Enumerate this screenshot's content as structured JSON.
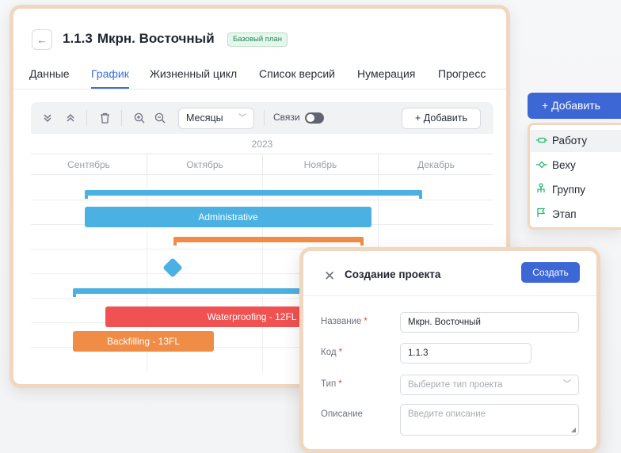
{
  "project": {
    "code": "1.1.3",
    "name": "Мкрн. Восточный",
    "plan_badge": "Базовый план",
    "back_icon": "arrow-left-icon"
  },
  "tabs": [
    {
      "label": "Данные",
      "active": false
    },
    {
      "label": "График",
      "active": true
    },
    {
      "label": "Жизненный цикл",
      "active": false
    },
    {
      "label": "Список версий",
      "active": false
    },
    {
      "label": "Нумерация",
      "active": false
    },
    {
      "label": "Прогресс",
      "active": false
    }
  ],
  "toolbar": {
    "expand_icon": "chevrons-down-icon",
    "collapse_icon": "chevrons-up-icon",
    "delete_icon": "trash-icon",
    "zoom_in_icon": "zoom-in-icon",
    "zoom_out_icon": "zoom-out-icon",
    "scale_select": "Месяцы",
    "links_label": "Связи",
    "links_enabled": false,
    "add_label": "+ Добавить"
  },
  "gantt": {
    "year": "2023",
    "months": [
      "Сентябрь",
      "Октябрь",
      "Ноябрь",
      "Декабрь"
    ],
    "bars": [
      {
        "type": "summary",
        "color": "#4bb1e3"
      },
      {
        "type": "task",
        "label": "Administrative",
        "color": "#4bb1e3"
      },
      {
        "type": "summary",
        "color": "#ef8c45"
      },
      {
        "type": "milestone",
        "color": "#4bb1e3"
      },
      {
        "type": "summary",
        "color": "#4bb1e3"
      },
      {
        "type": "task",
        "label": "Waterproofing - 12FL",
        "color": "#f05252"
      },
      {
        "type": "task",
        "label": "Backfilling - 13FL",
        "color": "#ef8c45"
      }
    ]
  },
  "add_menu": {
    "button_label": "+ Добавить",
    "items": [
      {
        "label": "Работу",
        "icon": "task-bar-icon",
        "highlighted": true
      },
      {
        "label": "Веху",
        "icon": "milestone-icon",
        "highlighted": false
      },
      {
        "label": "Группу",
        "icon": "group-tree-icon",
        "highlighted": false
      },
      {
        "label": "Этап",
        "icon": "flag-icon",
        "highlighted": false
      }
    ]
  },
  "dialog": {
    "title": "Создание проекта",
    "create_label": "Создать",
    "close_icon": "close-icon",
    "fields": {
      "name": {
        "label": "Название",
        "value": "Мкрн. Восточный",
        "required": true
      },
      "code": {
        "label": "Код",
        "value": "1.1.3",
        "required": true
      },
      "type": {
        "label": "Тип",
        "placeholder": "Выберите тип проекта",
        "required": true
      },
      "description": {
        "label": "Описание",
        "placeholder": "Введите описание",
        "required": false
      }
    }
  },
  "colors": {
    "accent": "#3e67d6",
    "panel_border": "#f1d7bf",
    "bar_blue": "#4bb1e3",
    "bar_orange": "#ef8c45",
    "bar_red": "#f05252"
  }
}
